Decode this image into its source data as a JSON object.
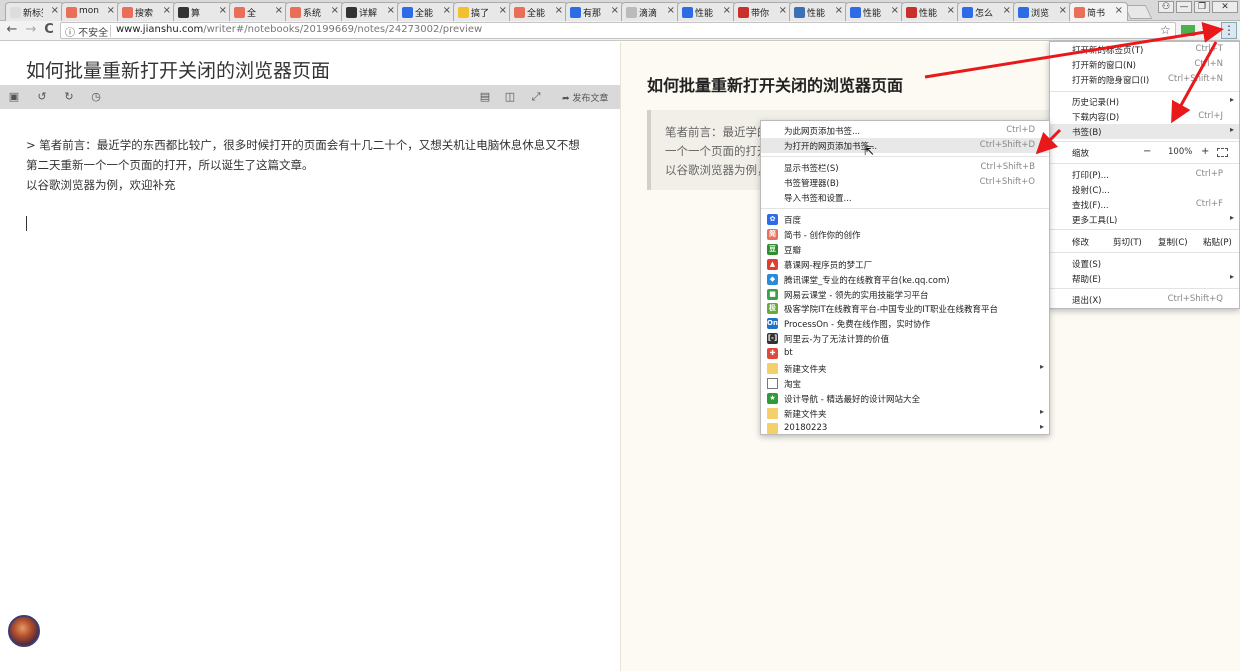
{
  "tabs": [
    {
      "label": "新标签页",
      "icon": "blank-tab-icon",
      "color": "#dddddd"
    },
    {
      "label": "mon",
      "icon": "jianshu-icon",
      "color": "#ea6f5a"
    },
    {
      "label": "搜索",
      "icon": "jianshu-icon",
      "color": "#ea6f5a"
    },
    {
      "label": "算",
      "icon": "aliyun-icon",
      "color": "#333333"
    },
    {
      "label": "全",
      "icon": "jianshu-icon",
      "color": "#ea6f5a"
    },
    {
      "label": "系统",
      "icon": "jianshu-icon",
      "color": "#ea6f5a"
    },
    {
      "label": "详解",
      "icon": "aliyun-icon",
      "color": "#333333"
    },
    {
      "label": "全能",
      "icon": "baidu-icon",
      "color": "#2e6be6"
    },
    {
      "label": "搞了",
      "icon": "smile-icon",
      "color": "#f0c030"
    },
    {
      "label": "全能",
      "icon": "jianshu-icon",
      "color": "#ea6f5a"
    },
    {
      "label": "有那",
      "icon": "baidu-icon",
      "color": "#2e6be6"
    },
    {
      "label": "滴滴",
      "icon": "page-icon",
      "color": "#bbbbbb"
    },
    {
      "label": "性能",
      "icon": "baidu-icon",
      "color": "#2e6be6"
    },
    {
      "label": "带你",
      "icon": "csdn-icon",
      "color": "#c9302c"
    },
    {
      "label": "性能",
      "icon": "chart-icon",
      "color": "#3b6fb6"
    },
    {
      "label": "性能",
      "icon": "baidu-icon",
      "color": "#2e6be6"
    },
    {
      "label": "性能",
      "icon": "csdn-icon",
      "color": "#c9302c"
    },
    {
      "label": "怎么",
      "icon": "baidu-icon",
      "color": "#2e6be6"
    },
    {
      "label": "浏览",
      "icon": "baidu-icon",
      "color": "#2e6be6"
    },
    {
      "label": "简书",
      "icon": "jianshu-icon",
      "color": "#ea6f5a"
    }
  ],
  "tab_close_glyph": "×",
  "window_buttons": {
    "user": "⚇",
    "minimize": "—",
    "restore": "❐",
    "close": "✕"
  },
  "address": {
    "security": "ⓘ 不安全",
    "host": "www.jianshu.com",
    "path": "/writer#/notebooks/20199669/notes/24273002/preview"
  },
  "nav": {
    "back": "←",
    "forward": "→",
    "reload": "C"
  },
  "editor": {
    "title": "如何批量重新打开关闭的浏览器页面",
    "publish_label": "发布文章",
    "lines": [
      "> 笔者前言：最近学的东西都比较广，很多时候打开的页面会有十几二十个，又想关机让电脑休息休息又不想",
      "第二天重新一个一个页面的打开，所以诞生了这篇文章。",
      "以谷歌浏览器为例，欢迎补充"
    ]
  },
  "preview": {
    "title": "如何批量重新打开关闭的浏览器页面",
    "quote_lines": [
      "笔者前言：最近学的东",
      "一个一个页面的打开",
      "以谷歌浏览器为例，欢"
    ]
  },
  "main_menu": {
    "items": [
      {
        "label": "打开新的标签页(T)",
        "shortcut": "Ctrl+T"
      },
      {
        "label": "打开新的窗口(N)",
        "shortcut": "Ctrl+N"
      },
      {
        "label": "打开新的隐身窗口(I)",
        "shortcut": "Ctrl+Shift+N"
      },
      {
        "label": "历史记录(H)",
        "shortcut": ""
      },
      {
        "label": "下载内容(D)",
        "shortcut": "Ctrl+J"
      },
      {
        "label": "书签(B)",
        "shortcut": ""
      },
      {
        "label": "打印(P)...",
        "shortcut": "Ctrl+P"
      },
      {
        "label": "投射(C)...",
        "shortcut": ""
      },
      {
        "label": "查找(F)...",
        "shortcut": "Ctrl+F"
      },
      {
        "label": "更多工具(L)",
        "shortcut": ""
      },
      {
        "label": "设置(S)",
        "shortcut": ""
      },
      {
        "label": "帮助(E)",
        "shortcut": ""
      },
      {
        "label": "退出(X)",
        "shortcut": "Ctrl+Shift+Q"
      }
    ],
    "zoom_label": "缩放",
    "zoom_minus": "−",
    "zoom_value": "100%",
    "zoom_plus": "+",
    "edit_label": "修改",
    "cut_label": "剪切(T)",
    "copy_label": "复制(C)",
    "paste_label": "粘贴(P)"
  },
  "bookmarks_menu": {
    "actions": [
      {
        "label": "为此网页添加书签...",
        "shortcut": "Ctrl+D"
      },
      {
        "label": "为打开的网页添加书签...",
        "shortcut": "Ctrl+Shift+D"
      },
      {
        "label": "显示书签栏(S)",
        "shortcut": "Ctrl+Shift+B"
      },
      {
        "label": "书签管理器(B)",
        "shortcut": "Ctrl+Shift+O"
      },
      {
        "label": "导入书签和设置...",
        "shortcut": ""
      }
    ],
    "bookmarks": [
      {
        "label": "百度",
        "icon": "baidu-icon",
        "color": "#2e6be6",
        "glyph": "✿"
      },
      {
        "label": "简书 - 创作你的创作",
        "icon": "jianshu-icon",
        "color": "#ea6f5a",
        "glyph": "简"
      },
      {
        "label": "豆瓣",
        "icon": "douban-icon",
        "color": "#2f8f2f",
        "glyph": "豆"
      },
      {
        "label": "慕课网-程序员的梦工厂",
        "icon": "imooc-icon",
        "color": "#e23b2f",
        "glyph": "▲"
      },
      {
        "label": "腾讯课堂_专业的在线教育平台(ke.qq.com)",
        "icon": "tencent-class-icon",
        "color": "#2a8bd9",
        "glyph": "◆"
      },
      {
        "label": "网易云课堂 - 领先的实用技能学习平台",
        "icon": "netease-class-icon",
        "color": "#3aa14a",
        "glyph": "■"
      },
      {
        "label": "极客学院IT在线教育平台-中国专业的IT职业在线教育平台",
        "icon": "jikexueyuan-icon",
        "color": "#6aa83a",
        "glyph": "极"
      },
      {
        "label": "ProcessOn - 免费在线作图，实时协作",
        "icon": "processon-icon",
        "color": "#1e73c8",
        "glyph": "On"
      },
      {
        "label": "阿里云-为了无法计算的价值",
        "icon": "aliyun-icon",
        "color": "#333333",
        "glyph": "[-]"
      },
      {
        "label": "bt",
        "icon": "bt-icon",
        "color": "#e04a3a",
        "glyph": "✚"
      },
      {
        "label": "新建文件夹",
        "icon": "folder-icon",
        "color": "#f5d06a",
        "glyph": ""
      },
      {
        "label": "淘宝",
        "icon": "page-icon",
        "color": "#ffffff",
        "glyph": ""
      },
      {
        "label": "设计导航 - 精选最好的设计网站大全",
        "icon": "shield-icon",
        "color": "#2f9a3a",
        "glyph": "★"
      },
      {
        "label": "新建文件夹",
        "icon": "folder-icon",
        "color": "#f5d06a",
        "glyph": ""
      },
      {
        "label": "20180223",
        "icon": "folder-icon",
        "color": "#f5d06a",
        "glyph": ""
      }
    ]
  },
  "submenu_arrow": "▸",
  "annotation_color": "#e8181b"
}
